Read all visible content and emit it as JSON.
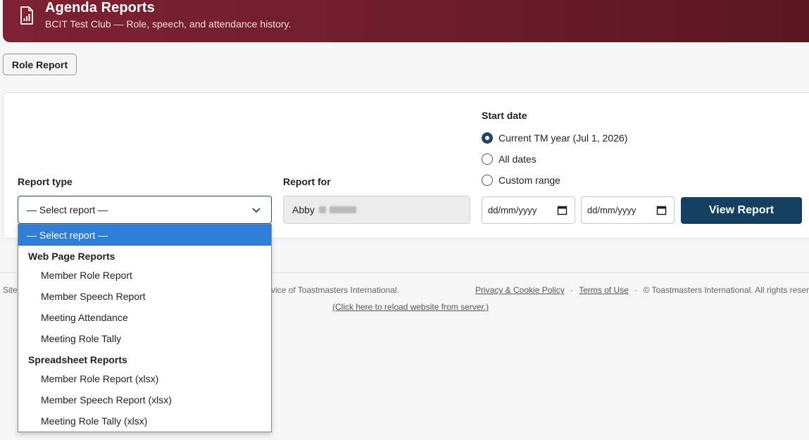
{
  "header": {
    "title": "Agenda Reports",
    "subtitle": "BCIT Test Club — Role, speech, and attendance history.",
    "logo_icon": "report-chart-icon"
  },
  "tabs": {
    "role_report": "Role Report"
  },
  "form": {
    "report_type_label": "Report type",
    "report_type_value": "— Select report —",
    "report_for_label": "Report for",
    "report_for_value": "Abby",
    "start_date_label": "Start date",
    "radio_options": [
      {
        "label": "Current TM year (Jul 1, 2026)",
        "checked": true
      },
      {
        "label": "All dates",
        "checked": false
      },
      {
        "label": "Custom range",
        "checked": false
      }
    ],
    "date_from_placeholder": "dd/mm/yyyy",
    "date_to_placeholder": "dd/mm/yyyy",
    "view_button": "View Report"
  },
  "dropdown": {
    "selected": "— Select report —",
    "groups": [
      {
        "label": "Web Page Reports",
        "items": [
          "Member Role Report",
          "Member Speech Report",
          "Meeting Attendance",
          "Meeting Role Tally"
        ]
      },
      {
        "label": "Spreadsheet Reports",
        "items": [
          "Member Role Report (xlsx)",
          "Member Speech Report (xlsx)",
          "Meeting Role Tally (xlsx)"
        ]
      }
    ]
  },
  "footer": {
    "left_fragment_start": "Site",
    "left_fragment_end": "vice of Toastmasters International.",
    "privacy_link": "Privacy & Cookie Policy",
    "separator": "·",
    "terms_link": "Terms of Use",
    "copyright": "© Toastmasters International. All rights reserve",
    "reload_link": "(Click here to reload website from server.)"
  },
  "colors": {
    "header_bg": "#7e2134",
    "primary_button": "#143f63",
    "dropdown_highlight": "#2f7fd9"
  }
}
